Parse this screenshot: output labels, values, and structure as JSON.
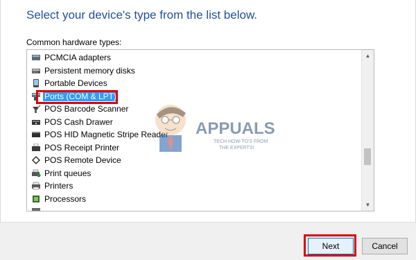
{
  "heading": "Select your device's type from the list below.",
  "list_label": "Common hardware types:",
  "items": [
    {
      "label": "PCMCIA adapters",
      "icon": "pcmcia-icon"
    },
    {
      "label": "Persistent memory disks",
      "icon": "memory-disk-icon"
    },
    {
      "label": "Portable Devices",
      "icon": "portable-device-icon"
    },
    {
      "label": "Ports (COM & LPT)",
      "icon": "port-icon",
      "selected": true
    },
    {
      "label": "POS Barcode Scanner",
      "icon": "barcode-scanner-icon"
    },
    {
      "label": "POS Cash Drawer",
      "icon": "cash-drawer-icon"
    },
    {
      "label": "POS HID Magnetic Stripe Reader",
      "icon": "stripe-reader-icon"
    },
    {
      "label": "POS Receipt Printer",
      "icon": "receipt-printer-icon"
    },
    {
      "label": "POS Remote Device",
      "icon": "remote-device-icon"
    },
    {
      "label": "Print queues",
      "icon": "print-queue-icon"
    },
    {
      "label": "Printers",
      "icon": "printer-icon"
    },
    {
      "label": "Processors",
      "icon": "processor-icon"
    }
  ],
  "watermark": {
    "brand": "APPUALS",
    "tagline_1": "TECH HOW-TO'S FROM",
    "tagline_2": "THE EXPERTS!"
  },
  "buttons": {
    "next": "Next",
    "cancel": "Cancel"
  },
  "colors": {
    "heading": "#1f4e9c",
    "selection": "#3399ff",
    "highlight_box": "#e00000"
  }
}
